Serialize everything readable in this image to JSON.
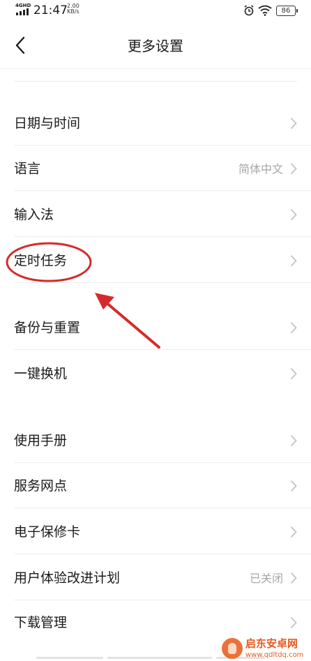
{
  "status_bar": {
    "network": "4GHD",
    "time": "21:47",
    "speed_value": "2.00",
    "speed_unit": "KB/s",
    "battery": "86"
  },
  "header": {
    "title": "更多设置"
  },
  "rows": [
    {
      "label": "日期与时间",
      "value": ""
    },
    {
      "label": "语言",
      "value": "简体中文"
    },
    {
      "label": "输入法",
      "value": ""
    },
    {
      "label": "定时任务",
      "value": ""
    },
    {
      "label": "备份与重置",
      "value": ""
    },
    {
      "label": "一键换机",
      "value": ""
    },
    {
      "label": "使用手册",
      "value": ""
    },
    {
      "label": "服务网点",
      "value": ""
    },
    {
      "label": "电子保修卡",
      "value": ""
    },
    {
      "label": "用户体验改进计划",
      "value": "已关闭"
    },
    {
      "label": "下载管理",
      "value": ""
    }
  ],
  "watermark": {
    "title": "启东安卓网",
    "url": "www.qdltdq.com"
  },
  "colors": {
    "annotation": "#d62a2a",
    "chevron": "#c4c4c4",
    "value_text": "#a6a6a6"
  }
}
